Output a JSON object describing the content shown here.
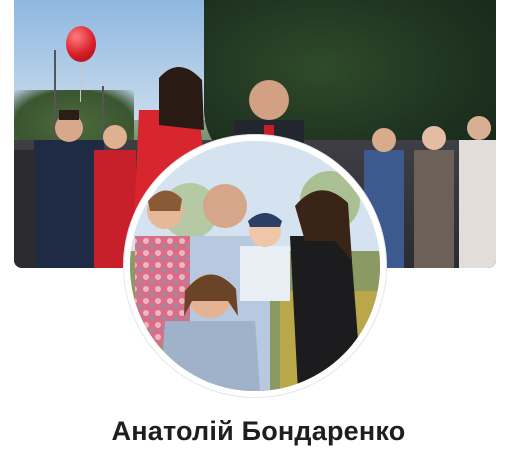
{
  "profile": {
    "name": "Анатолій Бондаренко",
    "cover_photo": "cover-photo",
    "profile_photo": "profile-photo"
  },
  "colors": {
    "background": "#ffffff",
    "name_text": "#1c1e21"
  }
}
